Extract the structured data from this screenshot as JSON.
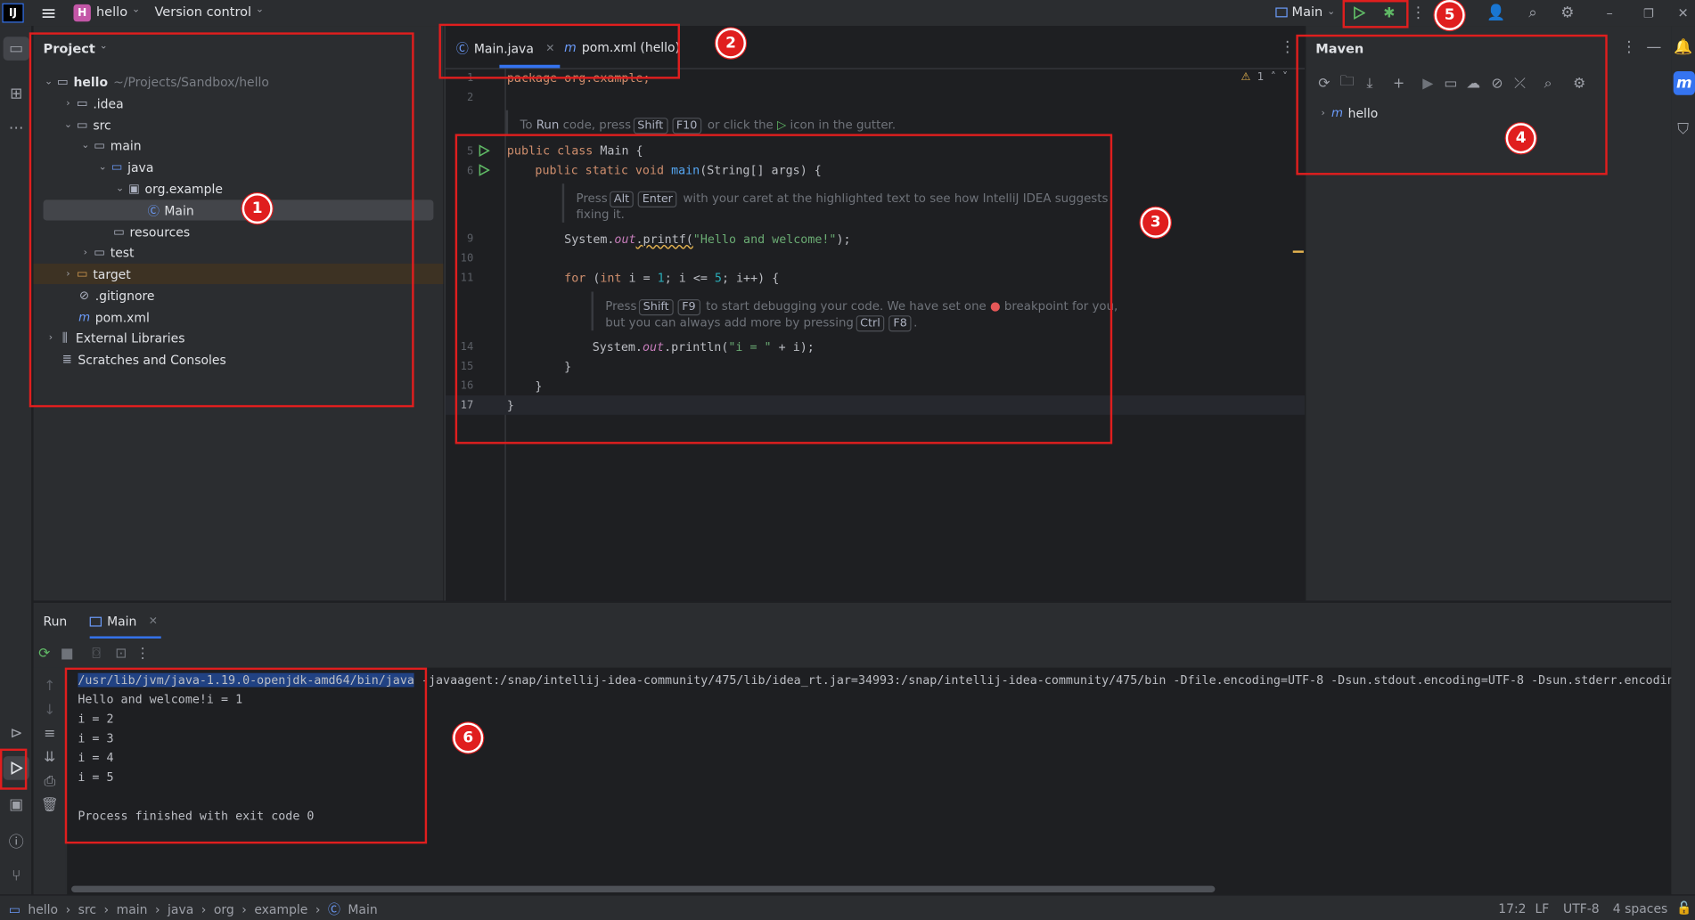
{
  "titlebar": {
    "project_badge": "H",
    "project_name": "hello",
    "vcs": "Version control",
    "run_config": "Main"
  },
  "project_panel": {
    "title": "Project",
    "root_name": "hello",
    "root_path": "~/Projects/Sandbox/hello",
    "items": [
      {
        "label": "hello",
        "icon": "folder-icon"
      },
      {
        "label": ".idea",
        "icon": "folder-icon"
      },
      {
        "label": "src",
        "icon": "folder-icon"
      },
      {
        "label": "main",
        "icon": "folder-icon"
      },
      {
        "label": "java",
        "icon": "source-folder-icon"
      },
      {
        "label": "org.example",
        "icon": "package-icon"
      },
      {
        "label": "Main",
        "icon": "class-icon"
      },
      {
        "label": "resources",
        "icon": "resources-folder-icon"
      },
      {
        "label": "test",
        "icon": "folder-icon"
      },
      {
        "label": "target",
        "icon": "folder-icon"
      },
      {
        "label": ".gitignore",
        "icon": "ignore-file-icon"
      },
      {
        "label": "pom.xml",
        "icon": "maven-icon"
      },
      {
        "label": "External Libraries",
        "icon": "library-icon"
      },
      {
        "label": "Scratches and Consoles",
        "icon": "scratches-icon"
      }
    ]
  },
  "editor": {
    "tabs": [
      {
        "label": "Main.java",
        "active": true
      },
      {
        "label": "pom.xml (hello)",
        "active": false
      }
    ],
    "warnings": "1",
    "line_numbers": [
      "1",
      "2",
      "5",
      "6",
      "9",
      "10",
      "11",
      "14",
      "15",
      "16",
      "17"
    ],
    "line1": "package org.example;",
    "hint_run_prefix": "To",
    "hint_run_word": "Run",
    "hint_run_mid": "code, press",
    "hint_run_key1": "Shift",
    "hint_run_key2": "F10",
    "hint_run_suffix1": "or click the",
    "hint_run_suffix2": "icon in the gutter.",
    "class_kw": "public class",
    "class_name": "Main {",
    "main_kw": "public static void",
    "main_fn": "main",
    "main_args": "(String[] args) {",
    "hint_alt_prefix": "Press",
    "hint_alt_key1": "Alt",
    "hint_alt_key2": "Enter",
    "hint_alt_suffix": "with your caret at the highlighted text to see how IntelliJ IDEA suggests",
    "hint_alt_line2": "fixing it.",
    "printf_pre": "System.",
    "printf_out": "out",
    "printf_fn": ".printf(",
    "printf_str": "\"Hello and welcome!\"",
    "printf_end": ");",
    "for_kw": "for",
    "for_rest_a": " (",
    "for_int": "int",
    "for_rest_b": " i = ",
    "for_1": "1",
    "for_rest_c": "; i <= ",
    "for_5": "5",
    "for_rest_d": "; i++) {",
    "hint_dbg_prefix": "Press",
    "hint_dbg_key1": "Shift",
    "hint_dbg_key2": "F9",
    "hint_dbg_suffix": "to start debugging your code. We have set one",
    "hint_dbg_suffix2": "breakpoint for you,",
    "hint_dbg_line2_prefix": "but you can always add more by pressing",
    "hint_dbg_key3": "Ctrl",
    "hint_dbg_key4": "F8",
    "println_pre": "System.",
    "println_out": "out",
    "println_fn": ".println(",
    "println_str": "\"i = \"",
    "println_end": " + i);",
    "close1": "}",
    "close2": "}",
    "close3": "}"
  },
  "maven": {
    "title": "Maven",
    "project": "hello"
  },
  "run_panel": {
    "tab_run": "Run",
    "tab_main": "Main",
    "cmd_selected": "/usr/lib/jvm/java-1.19.0-openjdk-amd64/bin/java",
    "cmd_rest": " -javaagent:/snap/intellij-idea-community/475/lib/idea_rt.jar=34993:/snap/intellij-idea-community/475/bin -Dfile.encoding=UTF-8 -Dsun.stdout.encoding=UTF-8 -Dsun.stderr.encoding",
    "output": [
      "Hello and welcome!i = 1",
      "i = 2",
      "i = 3",
      "i = 4",
      "i = 5",
      "",
      "Process finished with exit code 0"
    ]
  },
  "statusbar": {
    "breadcrumb": [
      "hello",
      "src",
      "main",
      "java",
      "org",
      "example",
      "Main"
    ],
    "position": "17:2",
    "line_sep": "LF",
    "encoding": "UTF-8",
    "indent": "4 spaces"
  },
  "annotations": [
    "1",
    "2",
    "3",
    "4",
    "5",
    "6"
  ],
  "colors": {
    "highlight_box": "#e01e1e",
    "accent": "#3574f0",
    "run_green": "#5fb865"
  }
}
